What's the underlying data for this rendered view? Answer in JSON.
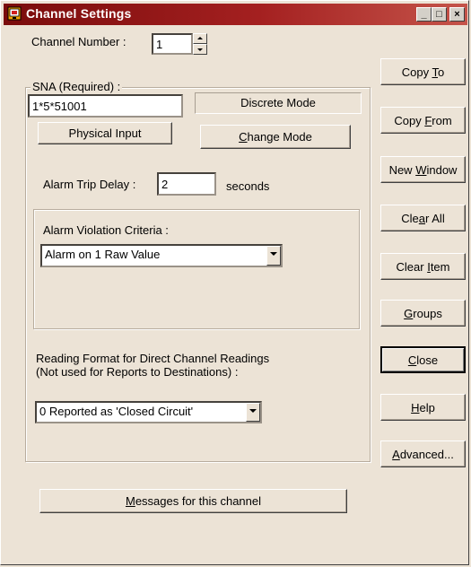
{
  "window": {
    "title": "Channel Settings"
  },
  "title_buttons": {
    "minimize": "_",
    "maximize": "□",
    "close": "×"
  },
  "channel": {
    "label": "Channel Number :",
    "value": "1"
  },
  "sna": {
    "legend": "SNA (Required) :",
    "value": "1*5*51001",
    "mode_display": "Discrete Mode",
    "physical_input_label": "Physical Input",
    "change_mode_label": {
      "pre": "",
      "mnemonic": "C",
      "post": "hange Mode"
    }
  },
  "alarm_trip": {
    "label": "Alarm Trip Delay :",
    "value": "2",
    "unit": "seconds"
  },
  "alarm_violation": {
    "legend": "Alarm Violation Criteria :",
    "selected": "Alarm on 1 Raw Value"
  },
  "reading_format": {
    "line1": "Reading Format for Direct Channel Readings",
    "line2": "(Not used for Reports to Destinations) :",
    "selected": "0 Reported as 'Closed Circuit'"
  },
  "messages_button": {
    "pre": "",
    "mnemonic": "M",
    "post": "essages for this channel"
  },
  "side_buttons": {
    "copy_to": {
      "pre": "Copy ",
      "mnemonic": "T",
      "post": "o"
    },
    "copy_from": {
      "pre": "Copy ",
      "mnemonic": "F",
      "post": "rom"
    },
    "new_window": {
      "pre": "New ",
      "mnemonic": "W",
      "post": "indow"
    },
    "clear_all": {
      "pre": "Cle",
      "mnemonic": "a",
      "post": "r All"
    },
    "clear_item": {
      "pre": "Clear ",
      "mnemonic": "I",
      "post": "tem"
    },
    "groups": {
      "pre": "",
      "mnemonic": "G",
      "post": "roups"
    },
    "close": {
      "pre": "",
      "mnemonic": "C",
      "post": "lose"
    },
    "help": {
      "pre": "",
      "mnemonic": "H",
      "post": "elp"
    },
    "advanced": {
      "pre": "",
      "mnemonic": "A",
      "post": "dvanced..."
    }
  }
}
